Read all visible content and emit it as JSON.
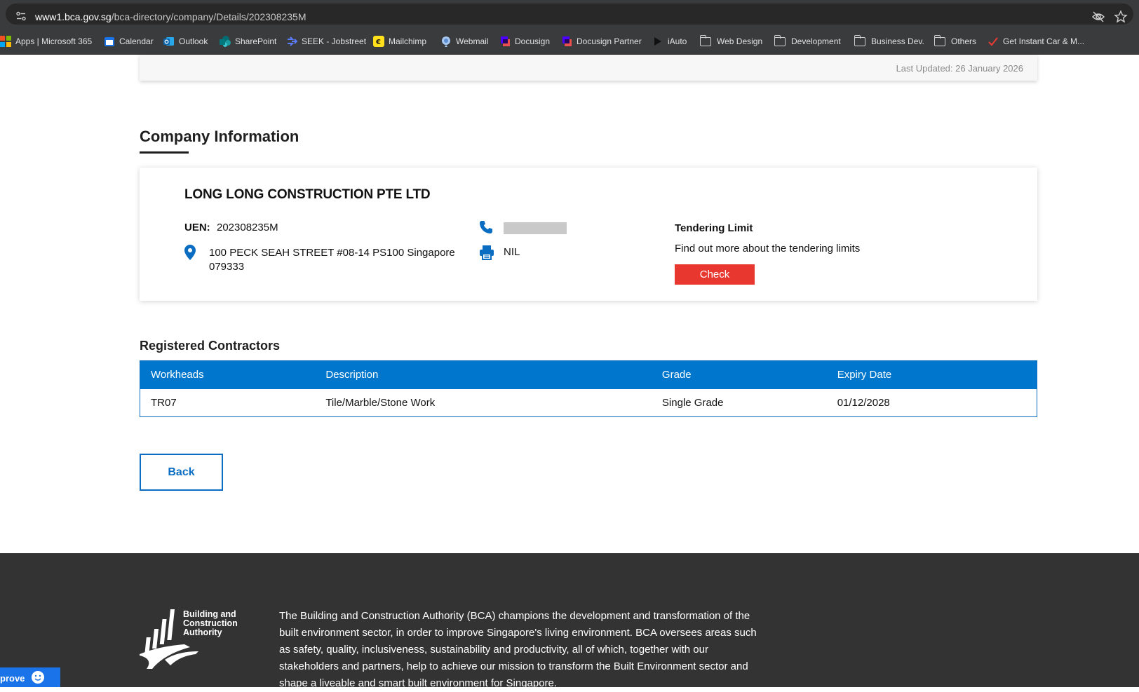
{
  "browser": {
    "url_host": "www1.bca.gov.sg",
    "url_path": "/bca-directory/company/Details/202308235M",
    "bookmarks": [
      {
        "label": "Apps | Microsoft 365",
        "icon": "microsoft-365-icon"
      },
      {
        "label": "Calendar",
        "icon": "calendar-icon"
      },
      {
        "label": "Outlook",
        "icon": "outlook-icon"
      },
      {
        "label": "SharePoint",
        "icon": "sharepoint-icon"
      },
      {
        "label": "SEEK - Jobstreet",
        "icon": "seek-icon"
      },
      {
        "label": "Mailchimp",
        "icon": "mailchimp-icon"
      },
      {
        "label": "Webmail",
        "icon": "webmail-icon"
      },
      {
        "label": "Docusign",
        "icon": "docusign-icon"
      },
      {
        "label": "Docusign Partner",
        "icon": "docusign-icon"
      },
      {
        "label": "iAuto",
        "icon": "play-icon"
      },
      {
        "label": "Web Design",
        "icon": "folder-icon"
      },
      {
        "label": "Development",
        "icon": "folder-icon"
      },
      {
        "label": "Business Dev.",
        "icon": "folder-icon"
      },
      {
        "label": "Others",
        "icon": "folder-icon"
      },
      {
        "label": "Get Instant Car & M...",
        "icon": "checkmark-icon"
      }
    ]
  },
  "page": {
    "last_updated": "Last Updated: 26 January 2026",
    "section_title": "Company Information",
    "company": {
      "name": "LONG LONG CONSTRUCTION PTE LTD",
      "uen_label": "UEN:",
      "uen_value": "202308235M",
      "address": "100 PECK SEAH STREET #08-14 PS100 Singapore 079333",
      "fax": "NIL",
      "tender_title": "Tendering Limit",
      "tender_text": "Find out more about the tendering limits",
      "check_label": "Check"
    },
    "registered_title": "Registered Contractors",
    "table": {
      "headers": [
        "Workheads",
        "Description",
        "Grade",
        "Expiry Date"
      ],
      "rows": [
        [
          "TR07",
          "Tile/Marble/Stone Work",
          "Single Grade",
          "01/12/2028"
        ]
      ]
    },
    "back_label": "Back"
  },
  "footer": {
    "logo_text": "Building and Construction Authority",
    "description": "The Building and Construction Authority (BCA) champions the development and transformation of the built environment sector, in order to improve Singapore's living environment. BCA oversees areas such as safety, quality, inclusiveness, sustainability and productivity, all of which, together with our stakeholders and partners, help to achieve our mission to transform the Built Environment sector and shape a liveable and smart built environment for Singapore."
  },
  "feedback_tab": {
    "label": "prove"
  },
  "colors": {
    "accent_blue": "#0077cc",
    "check_red": "#e8372f",
    "footer_bg": "#333333"
  }
}
